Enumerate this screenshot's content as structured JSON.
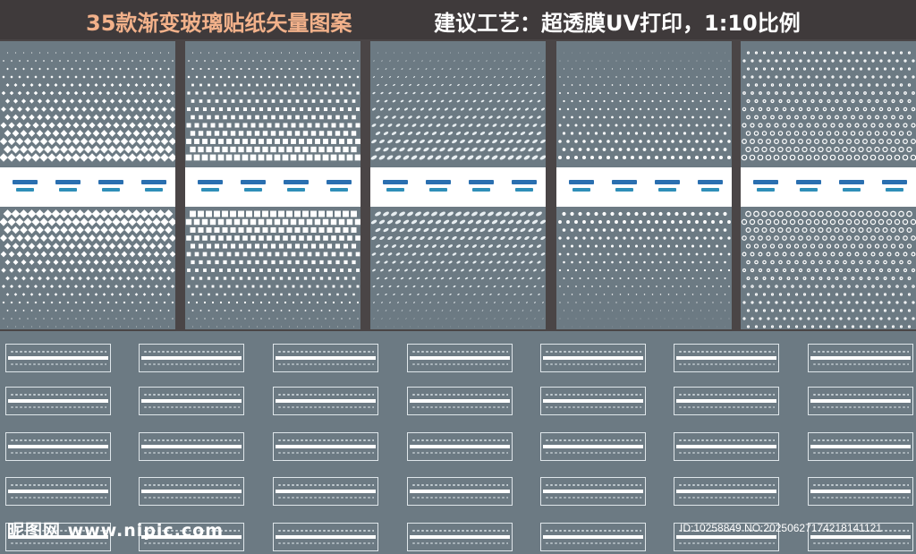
{
  "header": {
    "title": "35款渐变玻璃贴纸矢量图案",
    "process": "建议工艺：超透膜UV打印，1:10比例"
  },
  "colors": {
    "panel_bg": "#6c7a83",
    "frame": "#4a4546",
    "accent_title": "#f2b18a",
    "pattern": "#ffffff"
  },
  "panels": [
    {
      "pattern": "diamond"
    },
    {
      "pattern": "square"
    },
    {
      "pattern": "oval"
    },
    {
      "pattern": "dot"
    },
    {
      "pattern": "ring"
    }
  ],
  "watermark": {
    "site": "昵图网 www.nipic.com",
    "id": "ID:10258849 NO:20250627174218141121"
  }
}
